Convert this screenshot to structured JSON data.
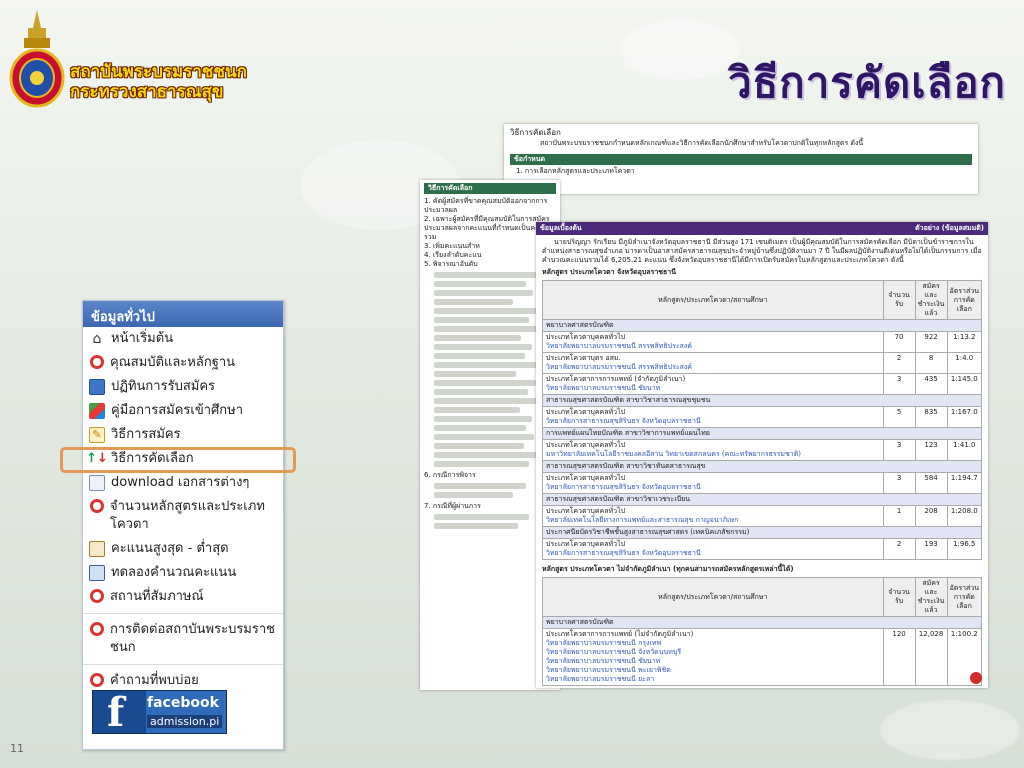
{
  "header": {
    "org_line1": "สถาบันพระบรมราชชนก",
    "org_line2": "กระทรวงสาธารณสุข",
    "slide_title": "วิธีการคัดเลือก",
    "slide_number": "11"
  },
  "sidebar": {
    "title": "ข้อมูลทั่วไป",
    "items": [
      {
        "label": "หน้าเริ่มต้น",
        "icon": "home-icon"
      },
      {
        "label": "คุณสมบัติและหลักฐาน",
        "icon": "lifebuoy-icon"
      },
      {
        "label": "ปฏิทินการรับสมัคร",
        "icon": "calendar-icon"
      },
      {
        "label": "คู่มือการสมัครเข้าศึกษา",
        "icon": "books-icon"
      },
      {
        "label": "วิธีการสมัคร",
        "icon": "pen-icon"
      },
      {
        "label": "วิธีการคัดเลือก",
        "icon": "arrows-icon"
      },
      {
        "label": "download เอกสารต่างๆ",
        "icon": "document-icon"
      },
      {
        "label": "จำนวนหลักสูตรและประเภทโควตา",
        "icon": "lifebuoy-icon"
      },
      {
        "label": "คะแนนสูงสุด - ต่ำสุด",
        "icon": "chart-icon"
      },
      {
        "label": "ทดลองคำนวณคะแนน",
        "icon": "calculator-icon"
      },
      {
        "label": "สถานที่สัมภาษณ์",
        "icon": "lifebuoy-icon"
      },
      {
        "label": "การติดต่อสถาบันพระบรมราชชนก",
        "icon": "lifebuoy-icon"
      },
      {
        "label": "คำถามที่พบบ่อย",
        "icon": "lifebuoy-icon"
      }
    ],
    "facebook_label": "facebook",
    "facebook_sub": "admission.pi"
  },
  "doc1": {
    "title": "วิธีการคัดเลือก",
    "intro": "สถาบันพระบรมราชชนกกำหนดหลักเกณฑ์และวิธีการคัดเลือกนักศึกษาสำหรับโควตาปกติในทุกหลักสูตร ดังนี้",
    "section": "ข้อกำหนด",
    "item1": "1. การเลือกหลักสูตรและประเภทโควตา"
  },
  "doc2": {
    "title": "วิธีการคัดเลือก",
    "items": [
      "1. คัดผู้สมัครที่ขาดคุณสมบัติออกจากการประมวลผล",
      "2. เฉพาะผู้สมัครที่มีคุณสมบัติในการสมัคร ประมวลผลจากคะแนนที่กำหนดเป็นคะแนนรวม",
      "3. เพิ่มคะแนนสำห",
      "4. เรียงลำดับคะแน",
      "5. พิจารณาอันดับ",
      "6. กรณีการพิจาร",
      "7. กรณีที่ผู้ผ่านการ"
    ]
  },
  "doc3": {
    "header_left": "ข้อมูลเบื้องต้น",
    "header_right": "ตัวอย่าง (ข้อมูลสมมติ)",
    "paragraph": "นายปริญญา รักเรียน มีภูมิลำเนาจังหวัดอุบลราชธานี มีส่วนสูง 171 เซนติเมตร เป็นผู้มีคุณสมบัติในการสมัครคัดเลือก มีบิดาเป็นข้าราชการในตำแหน่งสาธารณสุขอำเภอ มารดาเป็นอาสาสมัครสาธารณสุขประจำหมู่บ้านซึ่งปฏิบัติงานมา 7 ปี ในมีผลปฏิบัติงานดีเด่นหรือไม่ได้เป็นกรรมการ เมื่อคำนวณคะแนนรวมได้ 6,205.21 คะแนน ซึ่งจังหวัดอุบลราชธานีได้มีการเปิดรับสมัครในหลักสูตรและประเภทโควตา ดังนี้",
    "table1_title": "หลักสูตร ประเภทโควตา จังหวัดอุบลราชธานี",
    "table2_title": "หลักสูตร ประเภทโควตา ไม่จำกัดภูมิลำเนา (ทุกคนสามารถสมัครหลักสูตรเหล่านี้ได้)",
    "col_course": "หลักสูตร/ประเภทโควตา/สถานศึกษา",
    "col_seats": "จำนวนรับ",
    "col_applied": "สมัครและชำระเงินแล้ว",
    "col_ratio": "อัตราส่วนการคัดเลือก",
    "rows": [
      {
        "group": "พยาบาลศาสตรบัณฑิต"
      },
      {
        "name": "ประเภทโควตาบุคคลทั่วไป",
        "school": "วิทยาลัยพยาบาลบรมราชชนนี สรรพสิทธิประสงค์",
        "seats": "70",
        "applied": "922",
        "ratio": "1:13.2"
      },
      {
        "name": "ประเภทโควตาบุตร อสม.",
        "school": "วิทยาลัยพยาบาลบรมราชชนนี สรรพสิทธิประสงค์",
        "seats": "2",
        "applied": "8",
        "ratio": "1:4.0"
      },
      {
        "name": "ประเภทโควตาการการแพทย์ (จำกัดภูมิลำเนา)",
        "school": "วิทยาลัยพยาบาลบรมราชชนนี ชัยนาท",
        "seats": "3",
        "applied": "435",
        "ratio": "1:145.0"
      },
      {
        "group": "สาธารณสุขศาสตรบัณฑิต สาขาวิชาสาธารณสุขชุมชน"
      },
      {
        "name": "ประเภทโควตาบุคคลทั่วไป",
        "school": "วิทยาลัยการสาธารณสุขสิรินธร จังหวัดอุบลราชธานี",
        "seats": "5",
        "applied": "835",
        "ratio": "1:167.0"
      },
      {
        "group": "การแพทย์แผนไทยบัณฑิต สาขาวิชาการแพทย์แผนไทย"
      },
      {
        "name": "ประเภทโควตาบุคคลทั่วไป",
        "school": "มหาวิทยาลัยเทคโนโลยีราชมงคลอีสาน วิทยาเขตสกลนคร (คณะทรัพยากรธรรมชาติ)",
        "seats": "3",
        "applied": "123",
        "ratio": "1:41.0"
      },
      {
        "group": "สาธารณสุขศาสตรบัณฑิต สาขาวิชาทันตสาธารณสุข"
      },
      {
        "name": "ประเภทโควตาบุคคลทั่วไป",
        "school": "วิทยาลัยการสาธารณสุขสิรินธร จังหวัดอุบลราชธานี",
        "seats": "3",
        "applied": "584",
        "ratio": "1:194.7"
      },
      {
        "group": "สาธารณสุขศาสตรบัณฑิต สาขาวิชาเวชระเบียน"
      },
      {
        "name": "ประเภทโควตาบุคคลทั่วไป",
        "school": "วิทยาลัยเทคโนโลยีทางการแพทย์และสาธารณสุข กาญจนาภิเษก",
        "seats": "1",
        "applied": "208",
        "ratio": "1:208.0"
      },
      {
        "group": "ประกาศนียบัตรวิชาชีพชั้นสูงสาธารณสุขศาสตร (เทคนิคเภสัชกรรม)"
      },
      {
        "name": "ประเภทโควตาบุคคลทั่วไป",
        "school": "วิทยาลัยการสาธารณสุขสิรินธร จังหวัดอุบลราชธานี",
        "seats": "2",
        "applied": "193",
        "ratio": "1:96.5"
      }
    ],
    "rows2": [
      {
        "group": "พยาบาลศาสตรบัณฑิต"
      },
      {
        "name": "ประเภทโควตาการการแพทย์ (ไม่จำกัดภูมิลำเนา)",
        "schools": [
          "วิทยาลัยพยาบาลบรมราชชนนี กรุงเทพ",
          "วิทยาลัยพยาบาลบรมราชชนนี จังหวัดนนทบุรี",
          "วิทยาลัยพยาบาลบรมราชชนนี ชัยนาท",
          "วิทยาลัยพยาบาลบรมราชชนนี พะเยาพิชิต",
          "วิทยาลัยพยาบาลบรมราชชนนี ยะลา"
        ],
        "seats": "120",
        "applied": "12,028",
        "ratio": "1:100.2"
      }
    ]
  }
}
